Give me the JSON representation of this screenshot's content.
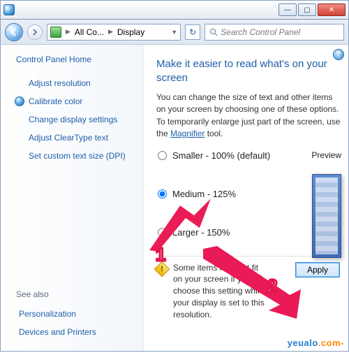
{
  "titlebar": {
    "title": ""
  },
  "addr": {
    "crumb_root": "All Co...",
    "crumb_current": "Display",
    "search_placeholder": "Search Control Panel"
  },
  "sidebar": {
    "home": "Control Panel Home",
    "items": [
      {
        "label": "Adjust resolution",
        "bullet": false
      },
      {
        "label": "Calibrate color",
        "bullet": true
      },
      {
        "label": "Change display settings",
        "bullet": false
      },
      {
        "label": "Adjust ClearType text",
        "bullet": false
      },
      {
        "label": "Set custom text size (DPI)",
        "bullet": false
      }
    ],
    "see_also_header": "See also",
    "see_also": [
      {
        "label": "Personalization"
      },
      {
        "label": "Devices and Printers"
      }
    ]
  },
  "main": {
    "help": "?",
    "heading": "Make it easier to read what's on your screen",
    "description_pre": "You can change the size of text and other items on your screen by choosing one of these options. To temporarily enlarge just part of the screen, use the ",
    "description_link": "Magnifier",
    "description_post": " tool.",
    "preview_label": "Preview",
    "options": [
      {
        "label": "Smaller - 100% (default)",
        "checked": false
      },
      {
        "label": "Medium - 125%",
        "checked": true
      },
      {
        "label": "Larger - 150%",
        "checked": false
      }
    ],
    "warning": "Some items may not fit on your screen if you choose this setting while your display is set to this resolution.",
    "apply_label": "Apply"
  },
  "annotations": {
    "step1": "1",
    "step2": "2"
  },
  "branding": {
    "part1": "yeualo",
    "part2": ".com-"
  }
}
